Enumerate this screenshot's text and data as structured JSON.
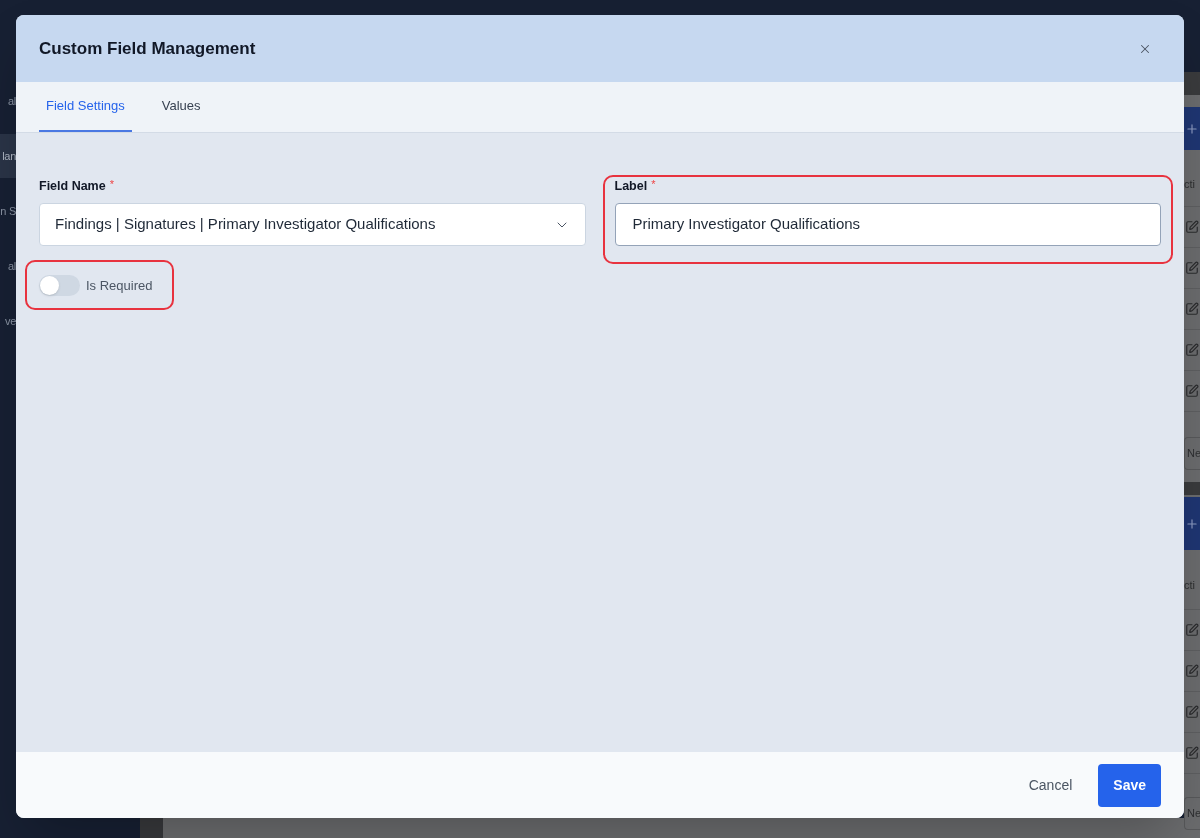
{
  "background": {
    "sidebar_items": [
      {
        "label": "al",
        "selected": false
      },
      {
        "label": "lan",
        "selected": true
      },
      {
        "label": "n S",
        "selected": false
      },
      {
        "label": "al",
        "selected": false
      },
      {
        "label": "ve",
        "selected": false
      }
    ],
    "panels": [
      {
        "column_header": "cti",
        "rows": [
          {
            "kind": "edit"
          },
          {
            "kind": "edit"
          },
          {
            "kind": "edit"
          },
          {
            "kind": "edit"
          },
          {
            "kind": "edit"
          }
        ],
        "pager_button": "Ne"
      },
      {
        "column_header": "cti",
        "rows": [
          {
            "kind": "edit"
          },
          {
            "kind": "edit"
          },
          {
            "kind": "edit"
          },
          {
            "kind": "edit"
          }
        ],
        "pager_button": "Ne"
      }
    ]
  },
  "dialog": {
    "title": "Custom Field Management",
    "tabs": [
      {
        "label": "Field Settings",
        "selected": true
      },
      {
        "label": "Values",
        "selected": false
      }
    ],
    "field_name": {
      "label": "Field Name",
      "required_mark": "*",
      "value": "Findings | Signatures | Primary Investigator Qualifications"
    },
    "label_field": {
      "label": "Label",
      "required_mark": "*",
      "value": "Primary Investigator Qualifications",
      "highlighted": true
    },
    "is_required": {
      "label": "Is Required",
      "on": false,
      "highlighted": true
    },
    "buttons": [
      {
        "label": "Cancel",
        "kind": "secondary"
      },
      {
        "label": "Save",
        "kind": "primary"
      }
    ]
  }
}
